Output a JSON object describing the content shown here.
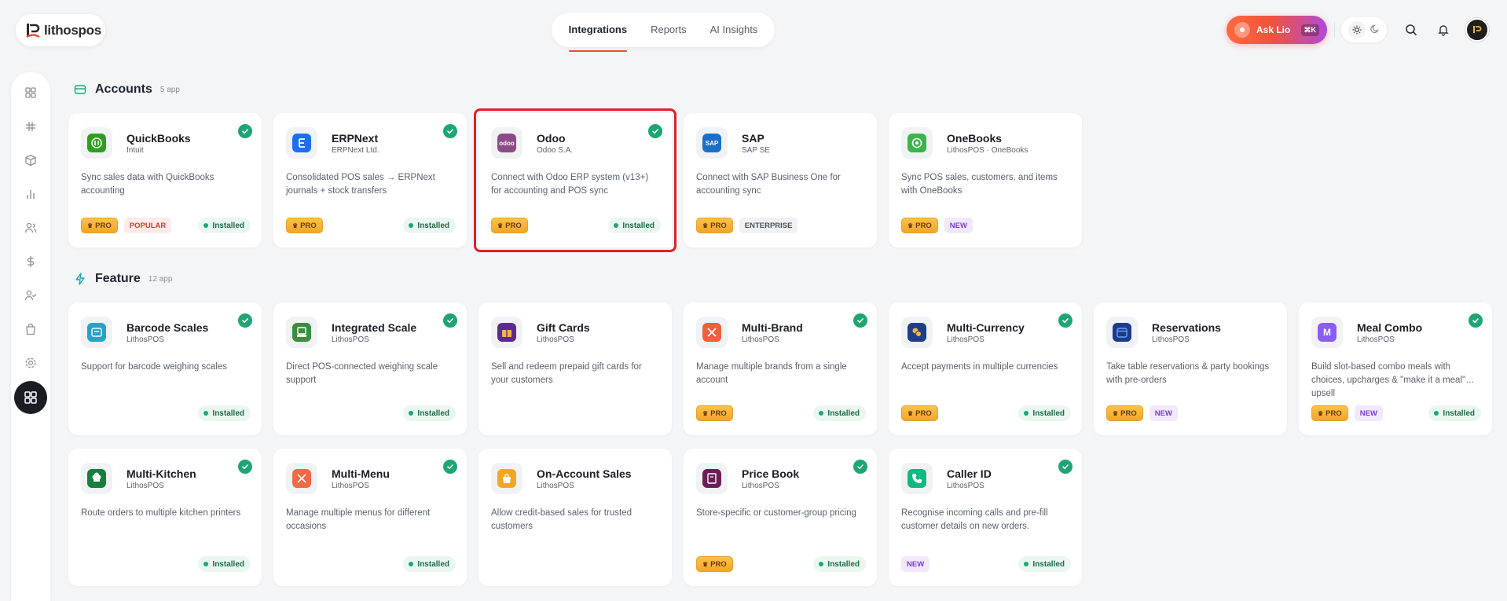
{
  "brand": {
    "name": "lithospos"
  },
  "nav": {
    "tabs": [
      {
        "label": "Integrations",
        "active": true
      },
      {
        "label": "Reports",
        "active": false
      },
      {
        "label": "AI Insights",
        "active": false
      }
    ]
  },
  "header": {
    "ask_label": "Ask Lio",
    "ask_shortcut": "⌘K"
  },
  "colors": {
    "accent": "#f04a34",
    "installed": "#1ea672",
    "pro": "#f3a52a",
    "selected_outline": "#d9232a"
  },
  "sidebar": {
    "items": [
      {
        "icon": "grid-icon"
      },
      {
        "icon": "sliders-icon"
      },
      {
        "icon": "box-icon"
      },
      {
        "icon": "bar-chart-icon"
      },
      {
        "icon": "users-icon"
      },
      {
        "icon": "dollar-icon"
      },
      {
        "icon": "user-check-icon"
      },
      {
        "icon": "shopping-bag-icon"
      },
      {
        "icon": "settings-icon"
      },
      {
        "icon": "apps-icon",
        "active": true
      }
    ]
  },
  "sections": {
    "accounts": {
      "title": "Accounts",
      "count": "5 app"
    },
    "feature": {
      "title": "Feature",
      "count": "12 app"
    }
  },
  "cards": [
    {
      "name": "QuickBooks",
      "vendor": "Intuit",
      "desc": "Sync sales data with QuickBooks accounting",
      "badges": [
        "PRO",
        "POPULAR"
      ],
      "installed": "Installed",
      "icon": "quickbooks-icon",
      "checked": true
    },
    {
      "name": "ERPNext",
      "vendor": "ERPNext Ltd.",
      "desc": "Consolidated POS sales → ERPNext journals + stock transfers",
      "badges": [
        "PRO"
      ],
      "installed": "Installed",
      "icon": "erpnext-icon",
      "checked": true
    },
    {
      "name": "Odoo",
      "vendor": "Odoo S.A.",
      "desc": "Connect with Odoo ERP system (v13+) for accounting and POS sync",
      "badges": [
        "PRO"
      ],
      "installed": "Installed",
      "icon": "odoo-icon",
      "checked": true,
      "selected": true,
      "icon_text": "odoo"
    },
    {
      "name": "SAP",
      "vendor": "SAP SE",
      "desc": "Connect with SAP Business One for accounting sync",
      "badges": [
        "PRO",
        "ENTERPRISE"
      ],
      "installed": null,
      "icon": "sap-icon",
      "checked": false,
      "icon_text": "SAP"
    },
    {
      "name": "OneBooks",
      "vendor": "LithosPOS · OneBooks",
      "desc": "Sync POS sales, customers, and items with OneBooks",
      "badges": [
        "PRO",
        "NEW"
      ],
      "installed": null,
      "icon": "onebooks-icon",
      "checked": false
    },
    {
      "name": "Barcode Scales",
      "vendor": "LithosPOS",
      "desc": "Support for barcode weighing scales",
      "badges": [],
      "installed": "Installed",
      "icon": "barcode-scale-icon",
      "checked": true
    },
    {
      "name": "Integrated Scale",
      "vendor": "LithosPOS",
      "desc": "Direct POS-connected weighing scale support",
      "badges": [],
      "installed": "Installed",
      "icon": "integrated-scale-icon",
      "checked": true
    },
    {
      "name": "Gift Cards",
      "vendor": "LithosPOS",
      "desc": "Sell and redeem prepaid gift cards for your customers",
      "badges": [],
      "installed": null,
      "icon": "gift-card-icon",
      "checked": false
    },
    {
      "name": "Multi-Brand",
      "vendor": "LithosPOS",
      "desc": "Manage multiple brands from a single account",
      "badges": [
        "PRO"
      ],
      "installed": "Installed",
      "icon": "multi-brand-icon",
      "checked": true
    },
    {
      "name": "Multi-Currency",
      "vendor": "LithosPOS",
      "desc": "Accept payments in multiple currencies",
      "badges": [
        "PRO"
      ],
      "installed": "Installed",
      "icon": "multi-currency-icon",
      "checked": true
    },
    {
      "name": "Reservations",
      "vendor": "LithosPOS",
      "desc": "Take table reservations & party bookings with pre-orders",
      "badges": [
        "PRO",
        "NEW"
      ],
      "installed": null,
      "icon": "calendar-icon",
      "checked": false
    },
    {
      "name": "Meal Combo",
      "vendor": "LithosPOS",
      "desc": "Build slot-based combo meals with choices, upcharges & \"make it a meal\"… upsell",
      "badges": [
        "PRO",
        "NEW"
      ],
      "installed": "Installed",
      "icon": "meal-combo-icon",
      "checked": true,
      "icon_text": "M"
    },
    {
      "name": "Multi-Kitchen",
      "vendor": "LithosPOS",
      "desc": "Route orders to multiple kitchen printers",
      "badges": [],
      "installed": "Installed",
      "icon": "multi-kitchen-icon",
      "checked": true
    },
    {
      "name": "Multi-Menu",
      "vendor": "LithosPOS",
      "desc": "Manage multiple menus for different occasions",
      "badges": [],
      "installed": "Installed",
      "icon": "multi-menu-icon",
      "checked": true
    },
    {
      "name": "On-Account Sales",
      "vendor": "LithosPOS",
      "desc": "Allow credit-based sales for trusted customers",
      "badges": [],
      "installed": null,
      "icon": "on-account-icon",
      "checked": false
    },
    {
      "name": "Price Book",
      "vendor": "LithosPOS",
      "desc": "Store-specific or customer-group pricing",
      "badges": [
        "PRO"
      ],
      "installed": "Installed",
      "icon": "price-book-icon",
      "checked": true
    },
    {
      "name": "Caller ID",
      "vendor": "LithosPOS",
      "desc": "Recognise incoming calls and pre-fill customer details on new orders.",
      "badges": [
        "NEW"
      ],
      "installed": "Installed",
      "icon": "caller-id-icon",
      "checked": true
    }
  ]
}
